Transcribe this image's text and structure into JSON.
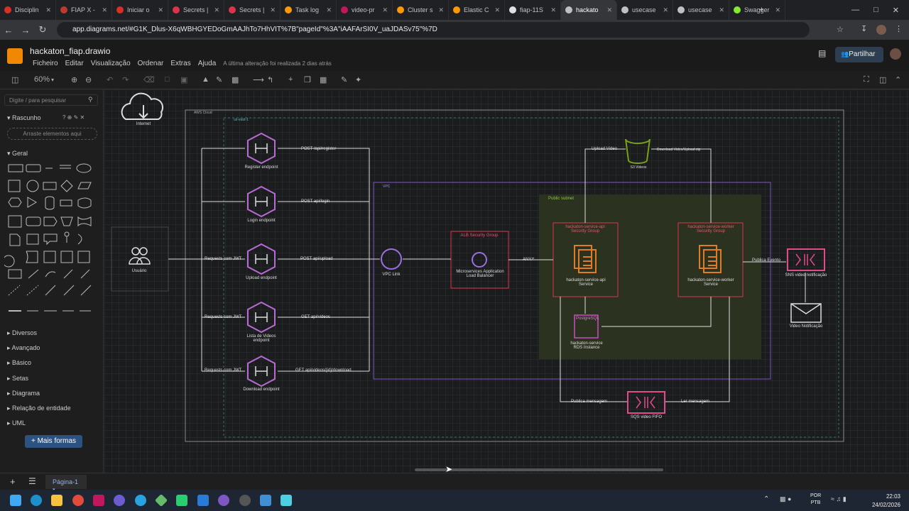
{
  "browser": {
    "tabs": [
      {
        "label": "Disciplin",
        "color": "#d93025"
      },
      {
        "label": "FIAP X -",
        "color": "#c0392b"
      },
      {
        "label": "Iniciar o",
        "color": "#d93025"
      },
      {
        "label": "Secrets |",
        "color": "#dd344c"
      },
      {
        "label": "Secrets |",
        "color": "#dd344c"
      },
      {
        "label": "Task log",
        "color": "#ff9900"
      },
      {
        "label": "video-pr",
        "color": "#c2185b"
      },
      {
        "label": "Cluster s",
        "color": "#ff9900"
      },
      {
        "label": "Elastic C",
        "color": "#ff9900"
      },
      {
        "label": "fiap-11S",
        "color": "#e0e0e0"
      },
      {
        "label": "hackato",
        "color": "#bdc1c6"
      },
      {
        "label": "usecase",
        "color": "#bdc1c6"
      },
      {
        "label": "usecase",
        "color": "#bdc1c6"
      },
      {
        "label": "Swagger",
        "color": "#85ea2d"
      }
    ],
    "url": "app.diagrams.net/#G1K_Dlus-X6qWBHGYEDoGmAAJhTo7HhVIT%7B\"pageId\"%3A\"iAAFArSI0V_uaJDASv75\"%7D"
  },
  "app": {
    "title": "hackaton_fiap.drawio",
    "menus": [
      "Ficheiro",
      "Editar",
      "Visualização",
      "Ordenar",
      "Extras",
      "Ajuda"
    ],
    "last_saved": "A última alteração foi realizada 2 dias atrás",
    "share": "Partilhar",
    "zoom": "60%"
  },
  "sidebar": {
    "search_placeholder": "Digite / para pesquisar",
    "scratchpad": "Rascunho",
    "dropzone": "Arraste elementos aqui",
    "general": "Geral",
    "sections": [
      "Diversos",
      "Avançado",
      "Básico",
      "Setas",
      "Diagrama",
      "Relação de entidade",
      "UML"
    ],
    "more_shapes": "+ Mais formas"
  },
  "page_tab": "Página-1",
  "diagram": {
    "internet": "Internet",
    "aws_cloud": "AWS Cloud",
    "region": "us-east-1",
    "vpc": "VPC",
    "public_subnet": "Public subnet",
    "users": "Usuário",
    "endpoints": [
      {
        "name": "Register endpoint",
        "route": "POST /api/register"
      },
      {
        "name": "Login endpoint",
        "route": "POST api/login"
      },
      {
        "name": "Upload endpoint",
        "route": "POST api/upload",
        "req": "Requests com JWT"
      },
      {
        "name": "Lista de Videos endpoint",
        "route": "GET api/videos",
        "req": "Requests com JWT"
      },
      {
        "name": "Download endpoint",
        "route": "GET api/videos/{id}/download",
        "req": "Requests com JWT"
      }
    ],
    "vpc_link": "VPC Link",
    "alb_group": "ALB Security Group",
    "alb": "Microservices Application Load Balancer",
    "any": "ANY/*",
    "api_group": "hackaton-service-api Security Group",
    "api_service": "hackaton-service-api Service",
    "worker_group": "hackaton-service-worker Security Group",
    "worker_service": "hackaton-service-worker Service",
    "postgres": "PostgreSQL",
    "rds": "hackaton-service RDS Instance",
    "s3": "S3 Videos",
    "upload_video": "Upload Video",
    "download_upload_zip": "Download Video/Upload zip",
    "publica_evento": "Publica Evento",
    "sns": "SNS video notificação",
    "email": "Video Notificação",
    "publica_mensagem": "Publica mensagem",
    "ler_mensagem": "Ler mensagem",
    "sqs": "SQS video FIFO"
  },
  "taskbar": {
    "lang": "POR",
    "layout": "PTB",
    "time": "22:03",
    "date": "24/02/2026"
  }
}
